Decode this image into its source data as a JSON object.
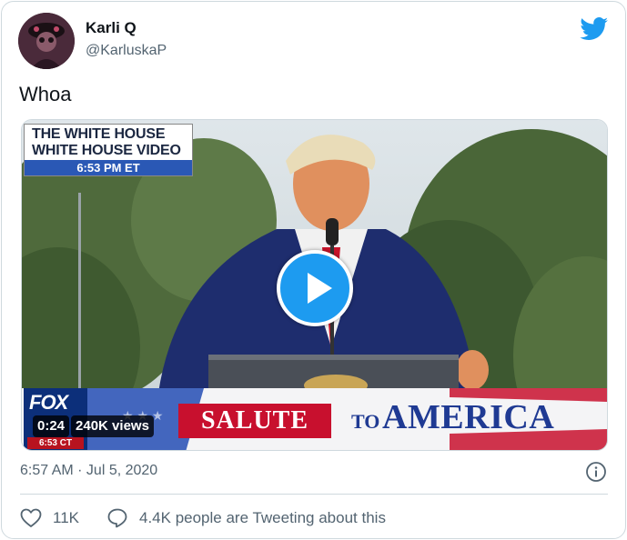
{
  "author": {
    "display_name": "Karli Q",
    "handle": "@KarluskaP"
  },
  "tweet": {
    "text": "Whoa",
    "timestamp": "6:57 AM · Jul 5, 2020"
  },
  "video": {
    "overlay_line1": "THE WHITE HOUSE",
    "overlay_line2": "WHITE HOUSE VIDEO",
    "overlay_time": "6:53 PM ET",
    "network": "FOX",
    "network_time": "6:53 CT",
    "banner_salute": "SALUTE",
    "banner_to": "TO",
    "banner_america": "AMERICA",
    "duration": "0:24",
    "views": "240K views"
  },
  "actions": {
    "likes": "11K",
    "tweeting": "4.4K people are Tweeting about this"
  },
  "colors": {
    "twitter_blue": "#1d9bf0",
    "secondary_text": "#536471",
    "border": "#cfd9de"
  },
  "icons": {
    "brand": "twitter-bird-icon",
    "play": "play-icon",
    "info": "info-icon",
    "like": "heart-icon",
    "reply": "speech-bubble-icon"
  }
}
